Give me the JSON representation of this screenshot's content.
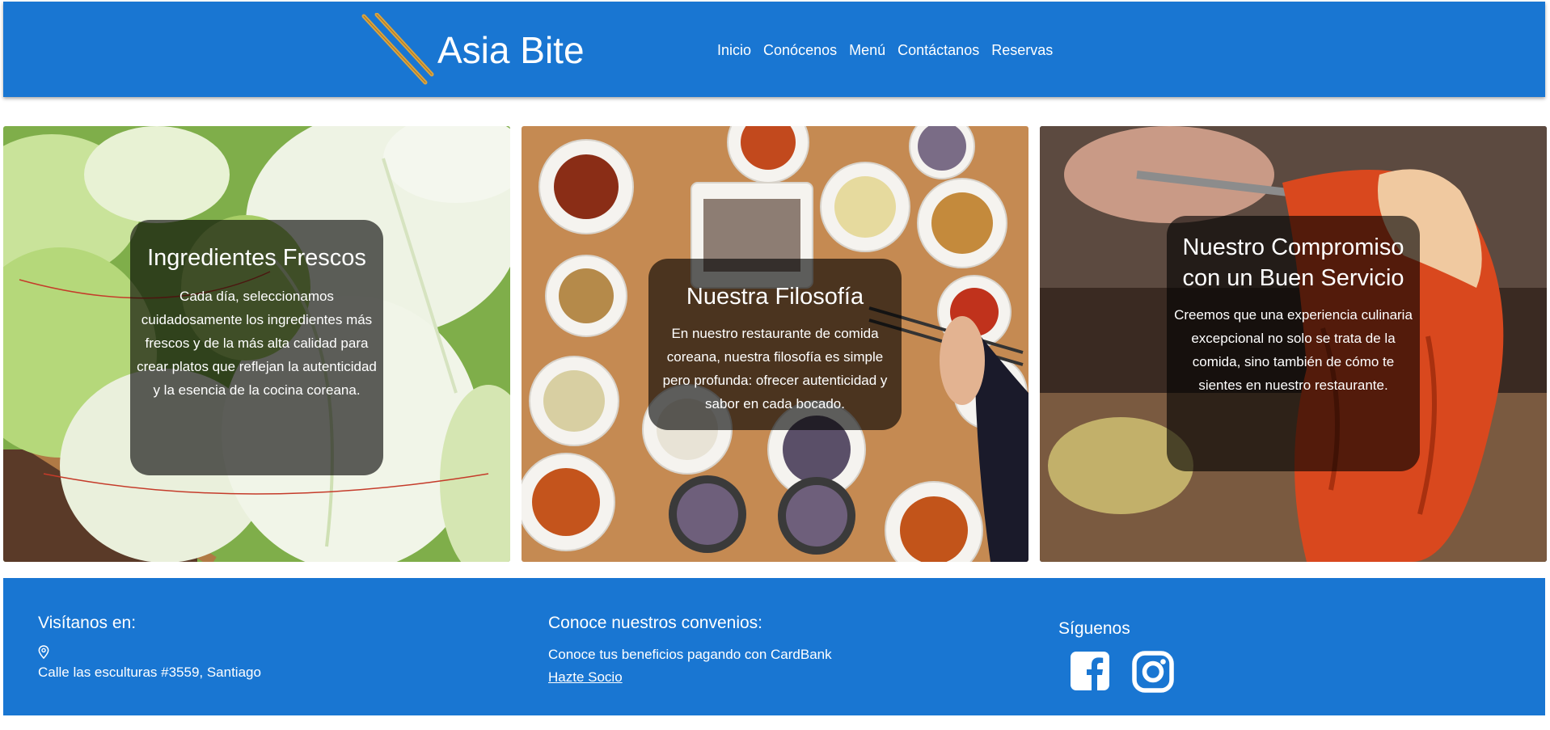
{
  "header": {
    "brand": "Asia Bite",
    "logo_icon": "chopsticks-icon",
    "nav": [
      "Inicio",
      "Conócenos",
      "Menú",
      "Contáctanos",
      "Reservas"
    ]
  },
  "cards": [
    {
      "image": "napa-cabbage-photo",
      "title": "Ingredientes Frescos",
      "text": "Cada día, seleccionamos cuidadosamente los ingredientes más frescos y de la más alta calidad para crear platos que reflejan la autenticidad y la esencia de la cocina coreana."
    },
    {
      "image": "korean-banchan-table-photo",
      "title": "Nuestra Filosofía",
      "text": "En nuestro restaurante de comida coreana, nuestra filosofía es simple pero profunda: ofrecer autenticidad y sabor en cada bocado."
    },
    {
      "image": "kimchi-chopsticks-photo",
      "title": "Nuestro Compromiso con un Buen Servicio",
      "text": "Creemos que una experiencia culinaria excepcional no solo se trata de la comida, sino también de cómo te sientes en nuestro restaurante."
    }
  ],
  "footer": {
    "visit": {
      "title": "Visítanos en:",
      "icon": "location-pin-icon",
      "address": "Calle las esculturas #3559, Santiago"
    },
    "agreements": {
      "title": "Conoce nuestros convenios:",
      "text": "Conoce tus beneficios pagando con CardBank",
      "link": "Hazte Socio"
    },
    "social": {
      "title": "Síguenos",
      "icons": [
        "facebook-icon",
        "instagram-icon"
      ]
    }
  },
  "colors": {
    "primary": "#1976d2",
    "overlay": "rgba(0,0,0,0.62)",
    "text": "#ffffff"
  }
}
